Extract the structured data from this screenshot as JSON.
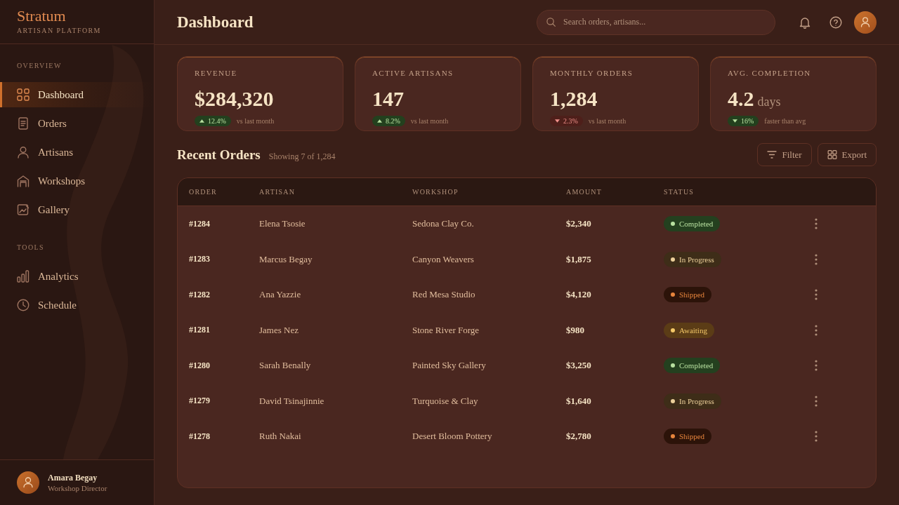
{
  "sidebar": {
    "brand": "Stratum",
    "tagline": "ARTISAN PLATFORM",
    "sections": [
      {
        "title": "OVERVIEW",
        "items": [
          {
            "label": "Dashboard",
            "selected": true
          },
          {
            "label": "Orders",
            "selected": false
          },
          {
            "label": "Artisans",
            "selected": false
          },
          {
            "label": "Workshops",
            "selected": false
          },
          {
            "label": "Gallery",
            "selected": false
          }
        ]
      },
      {
        "title": "TOOLS",
        "items": [
          {
            "label": "Analytics",
            "selected": false
          },
          {
            "label": "Schedule",
            "selected": false
          }
        ]
      }
    ],
    "user": {
      "name": "Amara Begay",
      "role": "Workshop Director"
    }
  },
  "header": {
    "title": "Dashboard",
    "search": {
      "placeholder": "Search orders, artisans..."
    }
  },
  "stats": [
    {
      "label": "REVENUE",
      "value": "$284,320",
      "delta": {
        "value": "12.4%",
        "up": true,
        "positive": true
      },
      "note": "vs last month"
    },
    {
      "label": "ACTIVE ARTISANS",
      "value": "147",
      "delta": {
        "value": "8.2%",
        "up": true,
        "positive": true
      },
      "note": "vs last month"
    },
    {
      "label": "MONTHLY ORDERS",
      "value": "1,284",
      "delta": {
        "value": "2.3%",
        "up": false,
        "positive": false
      },
      "note": "vs last month"
    },
    {
      "label": "AVG. COMPLETION",
      "value": "4.2",
      "unit": "days",
      "delta": {
        "value": "16%",
        "up": false,
        "positive": true
      },
      "note": "faster than avg"
    }
  ],
  "orders": {
    "title": "Recent Orders",
    "summary": "Showing 7 of 1,284",
    "actions": [
      "Filter",
      "Export"
    ]
  },
  "table": {
    "columns": [
      "ORDER",
      "ARTISAN",
      "WORKSHOP",
      "AMOUNT",
      "STATUS"
    ],
    "rows": [
      {
        "order": "#1284",
        "artisan": "Elena Tsosie",
        "workshop": "Sedona Clay Co.",
        "amount": "$2,340",
        "status": {
          "label": "Completed",
          "kind": "completed"
        }
      },
      {
        "order": "#1283",
        "artisan": "Marcus Begay",
        "workshop": "Canyon Weavers",
        "amount": "$1,875",
        "status": {
          "label": "In Progress",
          "kind": "in_progress"
        }
      },
      {
        "order": "#1282",
        "artisan": "Ana Yazzie",
        "workshop": "Red Mesa Studio",
        "amount": "$4,120",
        "status": {
          "label": "Shipped",
          "kind": "shipped"
        }
      },
      {
        "order": "#1281",
        "artisan": "James Nez",
        "workshop": "Stone River Forge",
        "amount": "$980",
        "status": {
          "label": "Awaiting",
          "kind": "awaiting"
        }
      },
      {
        "order": "#1280",
        "artisan": "Sarah Benally",
        "workshop": "Painted Sky Gallery",
        "amount": "$3,250",
        "status": {
          "label": "Completed",
          "kind": "completed"
        }
      },
      {
        "order": "#1279",
        "artisan": "David Tsinajinnie",
        "workshop": "Turquoise & Clay",
        "amount": "$1,640",
        "status": {
          "label": "In Progress",
          "kind": "in_progress"
        }
      },
      {
        "order": "#1278",
        "artisan": "Ruth Nakai",
        "workshop": "Desert Bloom Pottery",
        "amount": "$2,780",
        "status": {
          "label": "Shipped",
          "kind": "shipped"
        }
      }
    ]
  }
}
